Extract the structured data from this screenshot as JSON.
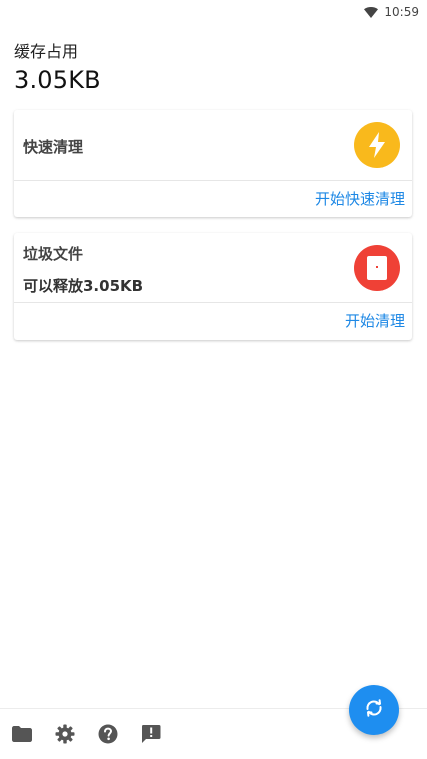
{
  "status_bar": {
    "time": "10:59",
    "wifi_icon": "wifi-icon"
  },
  "header": {
    "label": "缓存占用",
    "value": "3.05KB"
  },
  "cards": {
    "quick_clean": {
      "title": "快速清理",
      "action": "开始快速清理",
      "icon": "lightning-icon",
      "icon_color": "#F9B91C"
    },
    "junk_files": {
      "title": "垃圾文件",
      "subtitle": "可以释放3.05KB",
      "action": "开始清理",
      "icon": "document-icon",
      "icon_color": "#EF4136"
    }
  },
  "bottom_nav": [
    {
      "icon": "folder-icon"
    },
    {
      "icon": "gear-icon"
    },
    {
      "icon": "help-icon"
    },
    {
      "icon": "feedback-icon"
    }
  ],
  "fab": {
    "icon": "refresh-icon",
    "color": "#1E8EF0"
  },
  "colors": {
    "accent": "#1E88E5"
  }
}
